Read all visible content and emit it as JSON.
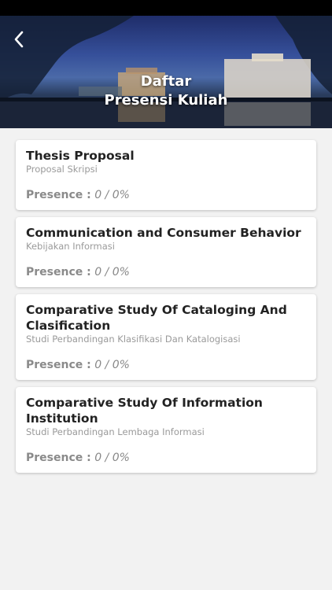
{
  "header": {
    "title_line1": "Daftar",
    "title_line2": "Presensi Kuliah",
    "back_icon": "chevron-left-icon"
  },
  "courses": [
    {
      "title": "Thesis Proposal",
      "subtitle": "Proposal Skripsi",
      "presence_label": "Presence :",
      "presence_value": "0 / 0%"
    },
    {
      "title": "Communication and Consumer Behavior",
      "subtitle": "Kebijakan Informasi",
      "presence_label": "Presence :",
      "presence_value": "0 / 0%"
    },
    {
      "title": "Comparative Study Of Cataloging And Clasification",
      "subtitle": "Studi Perbandingan Klasifikasi Dan Katalogisasi",
      "presence_label": "Presence :",
      "presence_value": "0 / 0%"
    },
    {
      "title": "Comparative Study Of Information Institution",
      "subtitle": "Studi Perbandingan Lembaga Informasi",
      "presence_label": "Presence :",
      "presence_value": "0 / 0%"
    }
  ],
  "colors": {
    "background": "#f2f2f2",
    "card": "#ffffff",
    "title_text": "#222222",
    "subtitle_text": "#9a9a9a"
  }
}
